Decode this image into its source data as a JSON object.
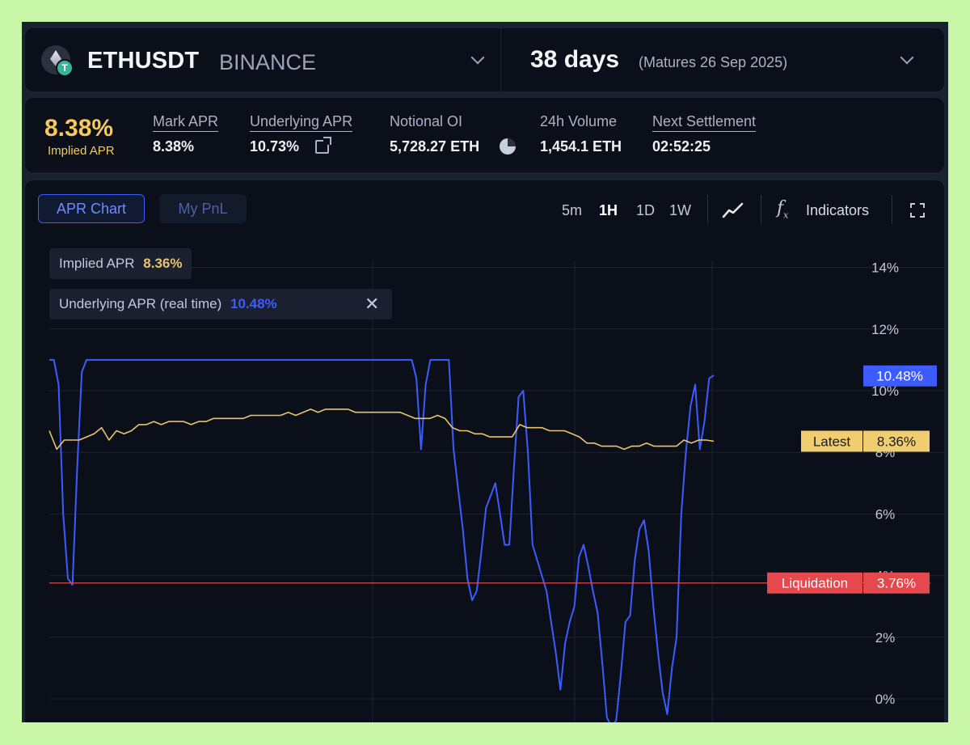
{
  "header": {
    "pair": "ETHUSDT",
    "exchange": "BINANCE",
    "maturity_days": "38 days",
    "matures": "(Matures 26 Sep 2025)"
  },
  "stats": {
    "implied_apr": "8.38%",
    "implied_apr_label": "Implied APR",
    "items": [
      {
        "label": "Mark APR",
        "value": "8.38%"
      },
      {
        "label": "Underlying APR",
        "value": "10.73%"
      },
      {
        "label": "Notional OI",
        "value": "5,728.27 ETH"
      },
      {
        "label": "24h Volume",
        "value": "1,454.1 ETH"
      },
      {
        "label": "Next Settlement",
        "value": "02:52:25"
      }
    ]
  },
  "toolbar": {
    "tabs": [
      "APR Chart",
      "My PnL"
    ],
    "timeframes": [
      "5m",
      "1H",
      "1D",
      "1W"
    ],
    "active_timeframe": "1H",
    "indicators_label": "Indicators"
  },
  "legend": {
    "implied_label": "Implied APR",
    "implied_value": "8.36%",
    "underlying_label": "Underlying APR (real time)",
    "underlying_value": "10.48%",
    "close_glyph": "✕"
  },
  "colors": {
    "implied": "#e9c46a",
    "underlying": "#3d5cff",
    "liquidation": "#e5484d",
    "accent": "#3d5bff"
  },
  "chart_data": {
    "type": "line",
    "y_ticks": [
      "14%",
      "12%",
      "10%",
      "8%",
      "6%",
      "4%",
      "2%",
      "0%"
    ],
    "ylim": [
      -1,
      14
    ],
    "grid": true,
    "series": [
      {
        "name": "Underlying APR (real time)",
        "color": "#3d5cff",
        "values": [
          11.0,
          11.0,
          10.2,
          6.0,
          3.9,
          3.7,
          7.5,
          10.6,
          11.0,
          11.0,
          11.0,
          11.0,
          11.0,
          11.0,
          11.0,
          11.0,
          11.0,
          11.0,
          11.0,
          11.0,
          11.0,
          11.0,
          11.0,
          11.0,
          11.0,
          11.0,
          11.0,
          11.0,
          11.0,
          11.0,
          11.0,
          11.0,
          11.0,
          11.0,
          11.0,
          11.0,
          11.0,
          11.0,
          11.0,
          11.0,
          11.0,
          11.0,
          11.0,
          11.0,
          11.0,
          11.0,
          11.0,
          11.0,
          11.0,
          11.0,
          11.0,
          11.0,
          11.0,
          11.0,
          11.0,
          11.0,
          11.0,
          11.0,
          11.0,
          11.0,
          11.0,
          11.0,
          11.0,
          11.0,
          11.0,
          11.0,
          11.0,
          11.0,
          11.0,
          11.0,
          11.0,
          11.0,
          11.0,
          11.0,
          11.0,
          11.0,
          11.0,
          11.0,
          11.0,
          10.4,
          8.1,
          10.2,
          11.0,
          11.0,
          11.0,
          11.0,
          11.0,
          8.1,
          6.8,
          5.5,
          3.9,
          3.2,
          3.5,
          4.8,
          6.2,
          6.6,
          7.0,
          6.0,
          5.0,
          5.0,
          7.5,
          9.8,
          10.0,
          8.0,
          5.0,
          4.5,
          4.0,
          3.5,
          2.5,
          1.5,
          0.3,
          1.8,
          2.5,
          3.0,
          4.6,
          5.0,
          4.3,
          3.5,
          2.8,
          1.2,
          -0.6,
          -0.9,
          -0.7,
          0.8,
          2.5,
          2.7,
          4.5,
          5.5,
          5.8,
          4.8,
          3.0,
          1.5,
          0.2,
          -0.5,
          1.0,
          2.0,
          6.0,
          8.0,
          9.5,
          10.2,
          8.1,
          9.0,
          10.4,
          10.5
        ],
        "last_value": 10.48,
        "last_label": "10.48%"
      },
      {
        "name": "Implied APR",
        "color": "#e9c46a",
        "values": [
          8.7,
          8.1,
          8.4,
          8.4,
          8.4,
          8.5,
          8.6,
          8.8,
          8.4,
          8.7,
          8.6,
          8.7,
          8.9,
          8.9,
          9.0,
          8.9,
          9.0,
          9.0,
          9.0,
          8.9,
          9.0,
          9.0,
          9.1,
          9.1,
          9.1,
          9.1,
          9.1,
          9.2,
          9.2,
          9.2,
          9.2,
          9.2,
          9.3,
          9.2,
          9.3,
          9.4,
          9.3,
          9.4,
          9.4,
          9.4,
          9.4,
          9.3,
          9.3,
          9.3,
          9.3,
          9.3,
          9.3,
          9.3,
          9.2,
          9.1,
          9.1,
          9.1,
          9.2,
          9.1,
          8.8,
          8.7,
          8.7,
          8.6,
          8.6,
          8.5,
          8.5,
          8.5,
          8.5,
          8.9,
          8.8,
          8.8,
          8.8,
          8.7,
          8.7,
          8.7,
          8.6,
          8.5,
          8.3,
          8.3,
          8.2,
          8.2,
          8.2,
          8.1,
          8.2,
          8.2,
          8.3,
          8.2,
          8.2,
          8.2,
          8.2,
          8.4,
          8.3,
          8.4,
          8.4,
          8.36
        ],
        "last_value": 8.36,
        "last_label": "8.36%",
        "tag": "Latest"
      }
    ],
    "reference_lines": [
      {
        "name": "Liquidation",
        "value": 3.76,
        "label": "3.76%",
        "color": "#e5484d"
      }
    ]
  }
}
